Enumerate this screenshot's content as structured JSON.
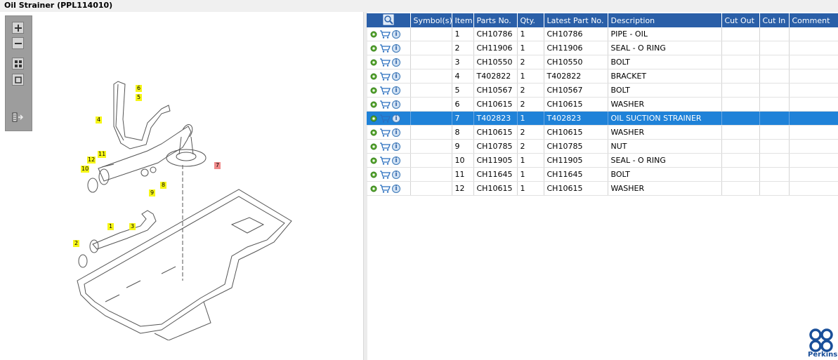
{
  "window": {
    "title": "Oil Strainer (PPL114010)"
  },
  "toolbar": {
    "items": [
      {
        "name": "zoom-in-icon"
      },
      {
        "name": "zoom-out-icon"
      },
      {
        "name": "fit-all-icon"
      },
      {
        "name": "fit-window-icon"
      },
      {
        "name": "export-list-icon"
      }
    ]
  },
  "diagram": {
    "callouts": [
      "1",
      "2",
      "3",
      "4",
      "5",
      "6",
      "7",
      "8",
      "9",
      "10",
      "11",
      "12"
    ],
    "selected_callout": "7"
  },
  "table": {
    "columns": [
      "Symbol(s)",
      "Item",
      "Parts No.",
      "Qty.",
      "Latest Part No.",
      "Description",
      "Cut Out",
      "Cut In",
      "Comment"
    ],
    "rows": [
      {
        "item": "1",
        "part": "CH10786",
        "qty": "1",
        "latest": "CH10786",
        "desc": "PIPE - OIL"
      },
      {
        "item": "2",
        "part": "CH11906",
        "qty": "1",
        "latest": "CH11906",
        "desc": "SEAL - O RING"
      },
      {
        "item": "3",
        "part": "CH10550",
        "qty": "2",
        "latest": "CH10550",
        "desc": "BOLT"
      },
      {
        "item": "4",
        "part": "T402822",
        "qty": "1",
        "latest": "T402822",
        "desc": "BRACKET"
      },
      {
        "item": "5",
        "part": "CH10567",
        "qty": "2",
        "latest": "CH10567",
        "desc": "BOLT"
      },
      {
        "item": "6",
        "part": "CH10615",
        "qty": "2",
        "latest": "CH10615",
        "desc": "WASHER"
      },
      {
        "item": "7",
        "part": "T402823",
        "qty": "1",
        "latest": "T402823",
        "desc": "OIL SUCTION STRAINER"
      },
      {
        "item": "8",
        "part": "CH10615",
        "qty": "2",
        "latest": "CH10615",
        "desc": "WASHER"
      },
      {
        "item": "9",
        "part": "CH10785",
        "qty": "2",
        "latest": "CH10785",
        "desc": "NUT"
      },
      {
        "item": "10",
        "part": "CH11905",
        "qty": "1",
        "latest": "CH11905",
        "desc": "SEAL - O RING"
      },
      {
        "item": "11",
        "part": "CH11645",
        "qty": "1",
        "latest": "CH11645",
        "desc": "BOLT"
      },
      {
        "item": "12",
        "part": "CH10615",
        "qty": "1",
        "latest": "CH10615",
        "desc": "WASHER"
      }
    ],
    "selected_item": "7"
  },
  "brand": {
    "name": "Perkins"
  },
  "colors": {
    "header_bg": "#2a5fa8",
    "selection": "#1f82d8",
    "callout": "#f6f617",
    "callout_selected": "#f08a8a"
  }
}
